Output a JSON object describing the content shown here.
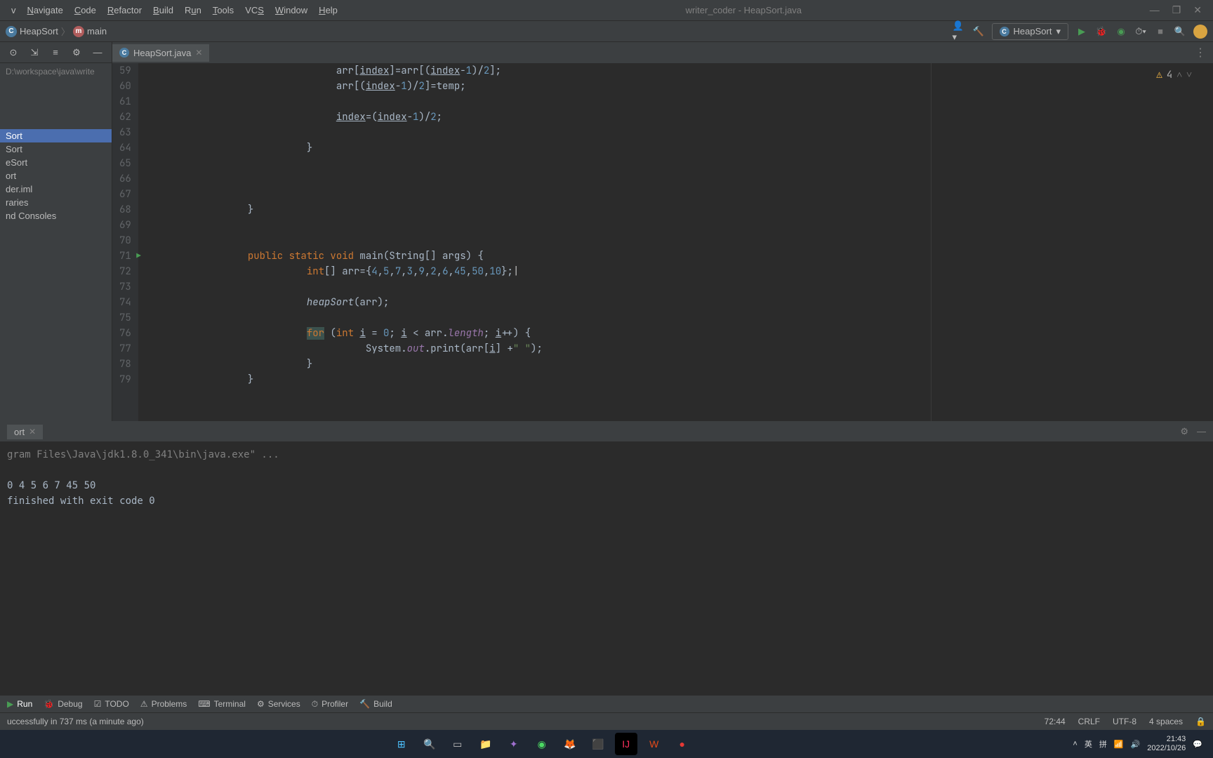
{
  "title": "writer_coder - HeapSort.java",
  "menu": [
    "Navigate",
    "Code",
    "Refactor",
    "Build",
    "Run",
    "Tools",
    "VCS",
    "Window",
    "Help"
  ],
  "breadcrumb": {
    "class_icon": "C",
    "class_name": "HeapSort",
    "method_icon": "m",
    "method_name": "main"
  },
  "run_config": "HeapSort",
  "sidebar": {
    "path": "D:\\workspace\\java\\write",
    "items": [
      "Sort",
      "Sort",
      "eSort",
      "ort",
      "der.iml",
      "raries",
      "nd Consoles"
    ],
    "selected_index": 0
  },
  "editor": {
    "tab": "HeapSort.java",
    "inspection_count": "4",
    "gutter_start": 59,
    "lines": [
      {
        "n": 59,
        "indent": 6,
        "tokens": [
          {
            "t": "arr[",
            "c": ""
          },
          {
            "t": "index",
            "c": "underline"
          },
          {
            "t": "]=arr[(",
            "c": ""
          },
          {
            "t": "index",
            "c": "underline"
          },
          {
            "t": "-",
            "c": ""
          },
          {
            "t": "1",
            "c": "num"
          },
          {
            "t": ")/",
            "c": ""
          },
          {
            "t": "2",
            "c": "num"
          },
          {
            "t": "];",
            "c": ""
          }
        ]
      },
      {
        "n": 60,
        "indent": 6,
        "tokens": [
          {
            "t": "arr[(",
            "c": ""
          },
          {
            "t": "index",
            "c": "underline"
          },
          {
            "t": "-",
            "c": ""
          },
          {
            "t": "1",
            "c": "num"
          },
          {
            "t": ")/",
            "c": ""
          },
          {
            "t": "2",
            "c": "num"
          },
          {
            "t": "]=temp;",
            "c": ""
          }
        ]
      },
      {
        "n": 61,
        "indent": 0,
        "tokens": []
      },
      {
        "n": 62,
        "indent": 6,
        "tokens": [
          {
            "t": "index",
            "c": "underline"
          },
          {
            "t": "=(",
            "c": ""
          },
          {
            "t": "index",
            "c": "underline"
          },
          {
            "t": "-",
            "c": ""
          },
          {
            "t": "1",
            "c": "num"
          },
          {
            "t": ")/",
            "c": ""
          },
          {
            "t": "2",
            "c": "num"
          },
          {
            "t": ";",
            "c": ""
          }
        ]
      },
      {
        "n": 63,
        "indent": 0,
        "tokens": []
      },
      {
        "n": 64,
        "indent": 5,
        "tokens": [
          {
            "t": "}",
            "c": ""
          }
        ]
      },
      {
        "n": 65,
        "indent": 0,
        "tokens": []
      },
      {
        "n": 66,
        "indent": 0,
        "tokens": []
      },
      {
        "n": 67,
        "indent": 0,
        "tokens": []
      },
      {
        "n": 68,
        "indent": 3,
        "tokens": [
          {
            "t": "}",
            "c": ""
          }
        ]
      },
      {
        "n": 69,
        "indent": 0,
        "tokens": []
      },
      {
        "n": 70,
        "indent": 0,
        "tokens": []
      },
      {
        "n": 71,
        "indent": 3,
        "run_icon": true,
        "tokens": [
          {
            "t": "public static ",
            "c": "kw"
          },
          {
            "t": "void ",
            "c": "kw"
          },
          {
            "t": "main",
            "c": ""
          },
          {
            "t": "(String[] args) {",
            "c": ""
          }
        ]
      },
      {
        "n": 72,
        "indent": 5,
        "caret": true,
        "tokens": [
          {
            "t": "int",
            "c": "kw"
          },
          {
            "t": "[] arr={",
            "c": ""
          },
          {
            "t": "4",
            "c": "num"
          },
          {
            "t": ",",
            "c": ""
          },
          {
            "t": "5",
            "c": "num"
          },
          {
            "t": ",",
            "c": ""
          },
          {
            "t": "7",
            "c": "num"
          },
          {
            "t": ",",
            "c": ""
          },
          {
            "t": "3",
            "c": "num"
          },
          {
            "t": ",",
            "c": ""
          },
          {
            "t": "9",
            "c": "num"
          },
          {
            "t": ",",
            "c": ""
          },
          {
            "t": "2",
            "c": "num"
          },
          {
            "t": ",",
            "c": ""
          },
          {
            "t": "6",
            "c": "num"
          },
          {
            "t": ",",
            "c": ""
          },
          {
            "t": "45",
            "c": "num"
          },
          {
            "t": ",",
            "c": ""
          },
          {
            "t": "50",
            "c": "num"
          },
          {
            "t": ",",
            "c": ""
          },
          {
            "t": "10",
            "c": "num"
          },
          {
            "t": "};",
            "c": ""
          }
        ]
      },
      {
        "n": 73,
        "indent": 0,
        "tokens": []
      },
      {
        "n": 74,
        "indent": 5,
        "tokens": [
          {
            "t": "heapSort",
            "c": "method-call"
          },
          {
            "t": "(arr);",
            "c": ""
          }
        ]
      },
      {
        "n": 75,
        "indent": 0,
        "tokens": []
      },
      {
        "n": 76,
        "indent": 5,
        "tokens": [
          {
            "t": "for",
            "c": "kw for-hl"
          },
          {
            "t": " (",
            "c": ""
          },
          {
            "t": "int ",
            "c": "kw"
          },
          {
            "t": "i",
            "c": "underline"
          },
          {
            "t": " = ",
            "c": ""
          },
          {
            "t": "0",
            "c": "num"
          },
          {
            "t": "; ",
            "c": ""
          },
          {
            "t": "i",
            "c": "underline"
          },
          {
            "t": " < arr.",
            "c": ""
          },
          {
            "t": "length",
            "c": "field"
          },
          {
            "t": "; ",
            "c": ""
          },
          {
            "t": "i",
            "c": "underline"
          },
          {
            "t": "++) {",
            "c": ""
          }
        ]
      },
      {
        "n": 77,
        "indent": 7,
        "tokens": [
          {
            "t": "System.",
            "c": ""
          },
          {
            "t": "out",
            "c": "field"
          },
          {
            "t": ".print(arr[",
            "c": ""
          },
          {
            "t": "i",
            "c": "underline"
          },
          {
            "t": "] +",
            "c": ""
          },
          {
            "t": "\" \"",
            "c": "str"
          },
          {
            "t": ");",
            "c": ""
          }
        ]
      },
      {
        "n": 78,
        "indent": 5,
        "tokens": [
          {
            "t": "}",
            "c": ""
          }
        ]
      },
      {
        "n": 79,
        "indent": 3,
        "tokens": [
          {
            "t": "}",
            "c": ""
          }
        ]
      }
    ]
  },
  "run_output": {
    "tab": "ort",
    "path": "gram Files\\Java\\jdk1.8.0_341\\bin\\java.exe\" ...",
    "result": "0 4 5 6 7 45 50",
    "exit": " finished with exit code 0"
  },
  "bottom_tabs": [
    "Run",
    "Debug",
    "TODO",
    "Problems",
    "Terminal",
    "Services",
    "Profiler",
    "Build"
  ],
  "status": {
    "message": "uccessfully in 737 ms (a minute ago)",
    "caret": "72:44",
    "lineend": "CRLF",
    "encoding": "UTF-8",
    "indent": "4 spaces"
  },
  "tray": {
    "ime1": "英",
    "ime2": "拼",
    "time": "21:43",
    "date": "2022/10/26"
  }
}
